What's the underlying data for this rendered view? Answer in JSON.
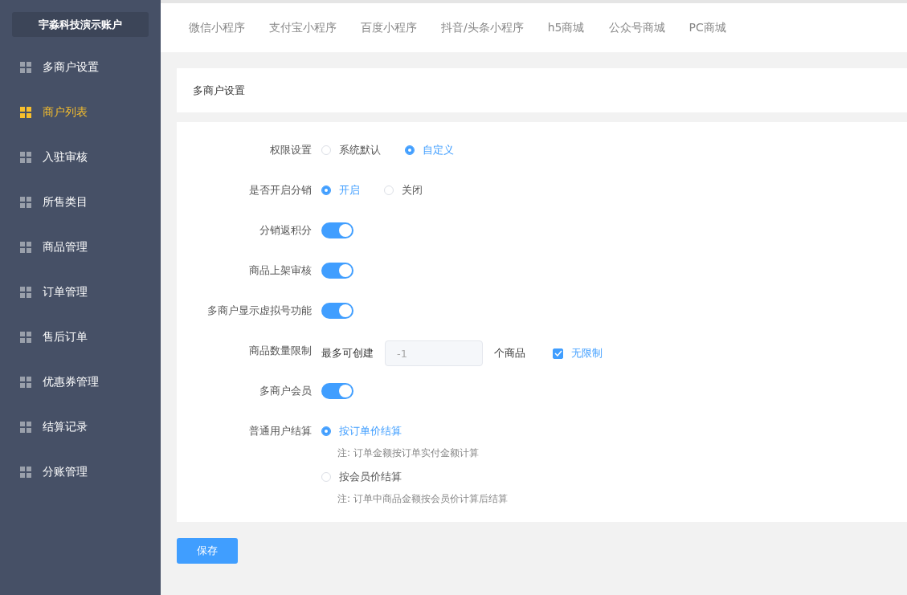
{
  "sidebar": {
    "account": "宇淼科技演示账户",
    "items": [
      {
        "label": "多商户设置",
        "selected": false
      },
      {
        "label": "商户列表",
        "selected": true
      },
      {
        "label": "入驻审核",
        "selected": false
      },
      {
        "label": "所售类目",
        "selected": false
      },
      {
        "label": "商品管理",
        "selected": false
      },
      {
        "label": "订单管理",
        "selected": false
      },
      {
        "label": "售后订单",
        "selected": false
      },
      {
        "label": "优惠券管理",
        "selected": false
      },
      {
        "label": "结算记录",
        "selected": false
      },
      {
        "label": "分账管理",
        "selected": false
      }
    ]
  },
  "tabs": [
    {
      "label": "微信小程序",
      "selected": false
    },
    {
      "label": "支付宝小程序",
      "selected": false
    },
    {
      "label": "百度小程序",
      "selected": false
    },
    {
      "label": "抖音/头条小程序",
      "selected": false
    },
    {
      "label": "h5商城",
      "selected": false
    },
    {
      "label": "公众号商城",
      "selected": false
    },
    {
      "label": "PC商城",
      "selected": false
    }
  ],
  "panel_title": "多商户设置",
  "form": [
    {
      "kind": "radio",
      "label": "权限设置",
      "options": [
        {
          "label": "系统默认",
          "selected": false
        },
        {
          "label": "自定义",
          "selected": true
        }
      ]
    },
    {
      "kind": "radio",
      "label": "是否开启分销",
      "options": [
        {
          "label": "开启",
          "selected": true
        },
        {
          "label": "关闭",
          "selected": false
        }
      ]
    },
    {
      "kind": "switch",
      "label": "分销返积分",
      "on": true
    },
    {
      "kind": "switch",
      "label": "商品上架审核",
      "on": true
    },
    {
      "kind": "switch",
      "label": "多商户显示虚拟号功能",
      "on": true
    },
    {
      "kind": "limit",
      "label": "商品数量限制",
      "prefix": "最多可创建",
      "value": "-1",
      "suffix": "个商品",
      "checkbox": {
        "label": "无限制",
        "checked": true
      }
    },
    {
      "kind": "switch",
      "label": "多商户会员",
      "on": true
    },
    {
      "kind": "radio_notes",
      "label": "普通用户结算",
      "options": [
        {
          "label": "按订单价结算",
          "selected": true,
          "note": "注: 订单金额按订单实付金额计算"
        },
        {
          "label": "按会员价结算",
          "selected": false,
          "note": "注: 订单中商品金额按会员价计算后结算"
        }
      ]
    }
  ],
  "save_button": "保存"
}
